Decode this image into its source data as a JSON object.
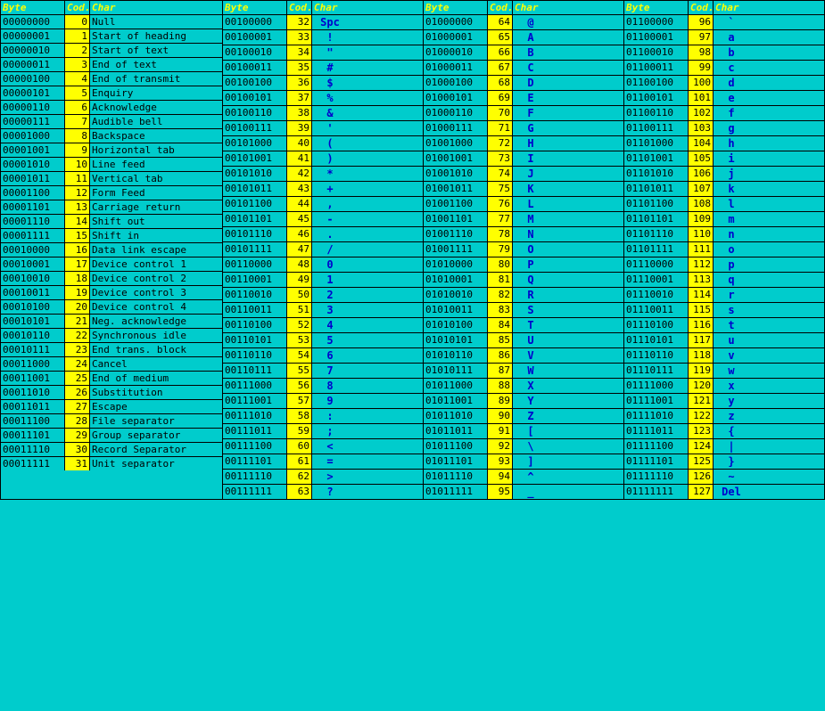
{
  "columns": [
    {
      "header": {
        "byte": "Byte",
        "cod": "Cod.",
        "char": "Char"
      },
      "rows": [
        {
          "byte": "00000000",
          "cod": "0",
          "char": "Null",
          "sym": ""
        },
        {
          "byte": "00000001",
          "cod": "1",
          "char": "Start of heading",
          "sym": ""
        },
        {
          "byte": "00000010",
          "cod": "2",
          "char": "Start of text",
          "sym": ""
        },
        {
          "byte": "00000011",
          "cod": "3",
          "char": "End of text",
          "sym": ""
        },
        {
          "byte": "00000100",
          "cod": "4",
          "char": "End of transmit",
          "sym": ""
        },
        {
          "byte": "00000101",
          "cod": "5",
          "char": "Enquiry",
          "sym": ""
        },
        {
          "byte": "00000110",
          "cod": "6",
          "char": "Acknowledge",
          "sym": ""
        },
        {
          "byte": "00000111",
          "cod": "7",
          "char": "Audible bell",
          "sym": ""
        },
        {
          "byte": "00001000",
          "cod": "8",
          "char": "Backspace",
          "sym": ""
        },
        {
          "byte": "00001001",
          "cod": "9",
          "char": "Horizontal tab",
          "sym": ""
        },
        {
          "byte": "00001010",
          "cod": "10",
          "char": "Line feed",
          "sym": ""
        },
        {
          "byte": "00001011",
          "cod": "11",
          "char": "Vertical tab",
          "sym": ""
        },
        {
          "byte": "00001100",
          "cod": "12",
          "char": "Form Feed",
          "sym": ""
        },
        {
          "byte": "00001101",
          "cod": "13",
          "char": "Carriage return",
          "sym": ""
        },
        {
          "byte": "00001110",
          "cod": "14",
          "char": "Shift out",
          "sym": ""
        },
        {
          "byte": "00001111",
          "cod": "15",
          "char": "Shift in",
          "sym": ""
        },
        {
          "byte": "00010000",
          "cod": "16",
          "char": "Data link escape",
          "sym": ""
        },
        {
          "byte": "00010001",
          "cod": "17",
          "char": "Device control 1",
          "sym": ""
        },
        {
          "byte": "00010010",
          "cod": "18",
          "char": "Device control 2",
          "sym": ""
        },
        {
          "byte": "00010011",
          "cod": "19",
          "char": "Device control 3",
          "sym": ""
        },
        {
          "byte": "00010100",
          "cod": "20",
          "char": "Device control 4",
          "sym": ""
        },
        {
          "byte": "00010101",
          "cod": "21",
          "char": "Neg. acknowledge",
          "sym": ""
        },
        {
          "byte": "00010110",
          "cod": "22",
          "char": "Synchronous idle",
          "sym": ""
        },
        {
          "byte": "00010111",
          "cod": "23",
          "char": "End trans. block",
          "sym": ""
        },
        {
          "byte": "00011000",
          "cod": "24",
          "char": "Cancel",
          "sym": ""
        },
        {
          "byte": "00011001",
          "cod": "25",
          "char": "End of medium",
          "sym": ""
        },
        {
          "byte": "00011010",
          "cod": "26",
          "char": "Substitution",
          "sym": ""
        },
        {
          "byte": "00011011",
          "cod": "27",
          "char": "Escape",
          "sym": ""
        },
        {
          "byte": "00011100",
          "cod": "28",
          "char": "File separator",
          "sym": ""
        },
        {
          "byte": "00011101",
          "cod": "29",
          "char": "Group separator",
          "sym": ""
        },
        {
          "byte": "00011110",
          "cod": "30",
          "char": "Record Separator",
          "sym": ""
        },
        {
          "byte": "00011111",
          "cod": "31",
          "char": "Unit separator",
          "sym": ""
        }
      ]
    },
    {
      "header": {
        "byte": "Byte",
        "cod": "Cod.",
        "char": "Char"
      },
      "rows": [
        {
          "byte": "00100000",
          "cod": "32",
          "char": "Spc",
          "sym": ""
        },
        {
          "byte": "00100001",
          "cod": "33",
          "char": "!",
          "sym": ""
        },
        {
          "byte": "00100010",
          "cod": "34",
          "char": "\"",
          "sym": ""
        },
        {
          "byte": "00100011",
          "cod": "35",
          "char": "#",
          "sym": ""
        },
        {
          "byte": "00100100",
          "cod": "36",
          "char": "$",
          "sym": ""
        },
        {
          "byte": "00100101",
          "cod": "37",
          "char": "%",
          "sym": ""
        },
        {
          "byte": "00100110",
          "cod": "38",
          "char": "&",
          "sym": ""
        },
        {
          "byte": "00100111",
          "cod": "39",
          "char": "'",
          "sym": ""
        },
        {
          "byte": "00101000",
          "cod": "40",
          "char": "(",
          "sym": ""
        },
        {
          "byte": "00101001",
          "cod": "41",
          "char": ")",
          "sym": ""
        },
        {
          "byte": "00101010",
          "cod": "42",
          "char": "*",
          "sym": ""
        },
        {
          "byte": "00101011",
          "cod": "43",
          "char": "+",
          "sym": ""
        },
        {
          "byte": "00101100",
          "cod": "44",
          "char": ",",
          "sym": ""
        },
        {
          "byte": "00101101",
          "cod": "45",
          "char": "-",
          "sym": ""
        },
        {
          "byte": "00101110",
          "cod": "46",
          "char": ".",
          "sym": ""
        },
        {
          "byte": "00101111",
          "cod": "47",
          "char": "/",
          "sym": ""
        },
        {
          "byte": "00110000",
          "cod": "48",
          "char": "0",
          "sym": ""
        },
        {
          "byte": "00110001",
          "cod": "49",
          "char": "1",
          "sym": ""
        },
        {
          "byte": "00110010",
          "cod": "50",
          "char": "2",
          "sym": ""
        },
        {
          "byte": "00110011",
          "cod": "51",
          "char": "3",
          "sym": ""
        },
        {
          "byte": "00110100",
          "cod": "52",
          "char": "4",
          "sym": ""
        },
        {
          "byte": "00110101",
          "cod": "53",
          "char": "5",
          "sym": ""
        },
        {
          "byte": "00110110",
          "cod": "54",
          "char": "6",
          "sym": ""
        },
        {
          "byte": "00110111",
          "cod": "55",
          "char": "7",
          "sym": ""
        },
        {
          "byte": "00111000",
          "cod": "56",
          "char": "8",
          "sym": ""
        },
        {
          "byte": "00111001",
          "cod": "57",
          "char": "9",
          "sym": ""
        },
        {
          "byte": "00111010",
          "cod": "58",
          "char": ":",
          "sym": ""
        },
        {
          "byte": "00111011",
          "cod": "59",
          "char": ";",
          "sym": ""
        },
        {
          "byte": "00111100",
          "cod": "60",
          "char": "<",
          "sym": ""
        },
        {
          "byte": "00111101",
          "cod": "61",
          "char": "=",
          "sym": ""
        },
        {
          "byte": "00111110",
          "cod": "62",
          "char": ">",
          "sym": ""
        },
        {
          "byte": "00111111",
          "cod": "63",
          "char": "?",
          "sym": ""
        }
      ]
    },
    {
      "header": {
        "byte": "Byte",
        "cod": "Cod.",
        "char": "Char"
      },
      "rows": [
        {
          "byte": "01000000",
          "cod": "64",
          "char": "@",
          "sym": ""
        },
        {
          "byte": "01000001",
          "cod": "65",
          "char": "A",
          "sym": ""
        },
        {
          "byte": "01000010",
          "cod": "66",
          "char": "B",
          "sym": ""
        },
        {
          "byte": "01000011",
          "cod": "67",
          "char": "C",
          "sym": ""
        },
        {
          "byte": "01000100",
          "cod": "68",
          "char": "D",
          "sym": ""
        },
        {
          "byte": "01000101",
          "cod": "69",
          "char": "E",
          "sym": ""
        },
        {
          "byte": "01000110",
          "cod": "70",
          "char": "F",
          "sym": ""
        },
        {
          "byte": "01000111",
          "cod": "71",
          "char": "G",
          "sym": ""
        },
        {
          "byte": "01001000",
          "cod": "72",
          "char": "H",
          "sym": ""
        },
        {
          "byte": "01001001",
          "cod": "73",
          "char": "I",
          "sym": ""
        },
        {
          "byte": "01001010",
          "cod": "74",
          "char": "J",
          "sym": ""
        },
        {
          "byte": "01001011",
          "cod": "75",
          "char": "K",
          "sym": ""
        },
        {
          "byte": "01001100",
          "cod": "76",
          "char": "L",
          "sym": ""
        },
        {
          "byte": "01001101",
          "cod": "77",
          "char": "M",
          "sym": ""
        },
        {
          "byte": "01001110",
          "cod": "78",
          "char": "N",
          "sym": ""
        },
        {
          "byte": "01001111",
          "cod": "79",
          "char": "O",
          "sym": ""
        },
        {
          "byte": "01010000",
          "cod": "80",
          "char": "P",
          "sym": ""
        },
        {
          "byte": "01010001",
          "cod": "81",
          "char": "Q",
          "sym": ""
        },
        {
          "byte": "01010010",
          "cod": "82",
          "char": "R",
          "sym": ""
        },
        {
          "byte": "01010011",
          "cod": "83",
          "char": "S",
          "sym": ""
        },
        {
          "byte": "01010100",
          "cod": "84",
          "char": "T",
          "sym": ""
        },
        {
          "byte": "01010101",
          "cod": "85",
          "char": "U",
          "sym": ""
        },
        {
          "byte": "01010110",
          "cod": "86",
          "char": "V",
          "sym": ""
        },
        {
          "byte": "01010111",
          "cod": "87",
          "char": "W",
          "sym": ""
        },
        {
          "byte": "01011000",
          "cod": "88",
          "char": "X",
          "sym": ""
        },
        {
          "byte": "01011001",
          "cod": "89",
          "char": "Y",
          "sym": ""
        },
        {
          "byte": "01011010",
          "cod": "90",
          "char": "Z",
          "sym": ""
        },
        {
          "byte": "01011011",
          "cod": "91",
          "char": "[",
          "sym": ""
        },
        {
          "byte": "01011100",
          "cod": "92",
          "char": "\\",
          "sym": ""
        },
        {
          "byte": "01011101",
          "cod": "93",
          "char": "]",
          "sym": ""
        },
        {
          "byte": "01011110",
          "cod": "94",
          "char": "^",
          "sym": ""
        },
        {
          "byte": "01011111",
          "cod": "95",
          "char": "_",
          "sym": ""
        }
      ]
    },
    {
      "header": {
        "byte": "Byte",
        "cod": "Cod.",
        "char": "Char"
      },
      "rows": [
        {
          "byte": "01100000",
          "cod": "96",
          "char": "`",
          "sym": ""
        },
        {
          "byte": "01100001",
          "cod": "97",
          "char": "a",
          "sym": ""
        },
        {
          "byte": "01100010",
          "cod": "98",
          "char": "b",
          "sym": ""
        },
        {
          "byte": "01100011",
          "cod": "99",
          "char": "c",
          "sym": ""
        },
        {
          "byte": "01100100",
          "cod": "100",
          "char": "d",
          "sym": ""
        },
        {
          "byte": "01100101",
          "cod": "101",
          "char": "e",
          "sym": ""
        },
        {
          "byte": "01100110",
          "cod": "102",
          "char": "f",
          "sym": ""
        },
        {
          "byte": "01100111",
          "cod": "103",
          "char": "g",
          "sym": ""
        },
        {
          "byte": "01101000",
          "cod": "104",
          "char": "h",
          "sym": ""
        },
        {
          "byte": "01101001",
          "cod": "105",
          "char": "i",
          "sym": ""
        },
        {
          "byte": "01101010",
          "cod": "106",
          "char": "j",
          "sym": ""
        },
        {
          "byte": "01101011",
          "cod": "107",
          "char": "k",
          "sym": ""
        },
        {
          "byte": "01101100",
          "cod": "108",
          "char": "l",
          "sym": ""
        },
        {
          "byte": "01101101",
          "cod": "109",
          "char": "m",
          "sym": ""
        },
        {
          "byte": "01101110",
          "cod": "110",
          "char": "n",
          "sym": ""
        },
        {
          "byte": "01101111",
          "cod": "111",
          "char": "o",
          "sym": ""
        },
        {
          "byte": "01110000",
          "cod": "112",
          "char": "p",
          "sym": ""
        },
        {
          "byte": "01110001",
          "cod": "113",
          "char": "q",
          "sym": ""
        },
        {
          "byte": "01110010",
          "cod": "114",
          "char": "r",
          "sym": ""
        },
        {
          "byte": "01110011",
          "cod": "115",
          "char": "s",
          "sym": ""
        },
        {
          "byte": "01110100",
          "cod": "116",
          "char": "t",
          "sym": ""
        },
        {
          "byte": "01110101",
          "cod": "117",
          "char": "u",
          "sym": ""
        },
        {
          "byte": "01110110",
          "cod": "118",
          "char": "v",
          "sym": ""
        },
        {
          "byte": "01110111",
          "cod": "119",
          "char": "w",
          "sym": ""
        },
        {
          "byte": "01111000",
          "cod": "120",
          "char": "x",
          "sym": ""
        },
        {
          "byte": "01111001",
          "cod": "121",
          "char": "y",
          "sym": ""
        },
        {
          "byte": "01111010",
          "cod": "122",
          "char": "z",
          "sym": ""
        },
        {
          "byte": "01111011",
          "cod": "123",
          "char": "{",
          "sym": ""
        },
        {
          "byte": "01111100",
          "cod": "124",
          "char": "|",
          "sym": ""
        },
        {
          "byte": "01111101",
          "cod": "125",
          "char": "}",
          "sym": ""
        },
        {
          "byte": "01111110",
          "cod": "126",
          "char": "~",
          "sym": ""
        },
        {
          "byte": "01111111",
          "cod": "127",
          "char": "Del",
          "sym": ""
        }
      ]
    }
  ]
}
